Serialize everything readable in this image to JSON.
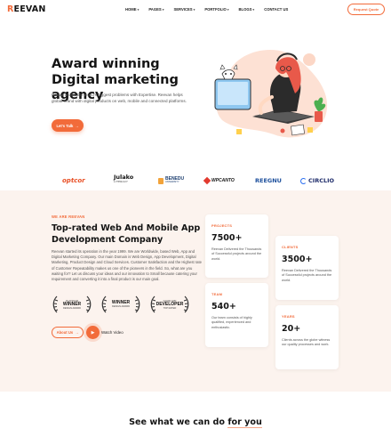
{
  "header": {
    "logo_first": "R",
    "logo_rest": "EEVAN",
    "nav": [
      {
        "label": "HOME",
        "has_dropdown": true
      },
      {
        "label": "PAGES",
        "has_dropdown": true
      },
      {
        "label": "SERVICES",
        "has_dropdown": true
      },
      {
        "label": "PORTFOLIO",
        "has_dropdown": true
      },
      {
        "label": "BLOGS",
        "has_dropdown": true
      },
      {
        "label": "CONTACT US",
        "has_dropdown": false
      }
    ],
    "request_button": "Request Quote"
  },
  "hero": {
    "title_highlight": "Award",
    "title_rest": " winning Digital marketing agency",
    "description": "Reevan solve the world's biggest problems with Expertise. Reevan helps global brand with digital products on web, mobile and connected platforms.",
    "cta_label": "Let's Talk",
    "cta_icon": "arrow-right"
  },
  "brands": [
    {
      "name": "optcor"
    },
    {
      "name": "Julako",
      "sub": "LITERACY"
    },
    {
      "name": "BENEDU",
      "sub": "UNIVERSITY"
    },
    {
      "name": "WPCANTO"
    },
    {
      "name": "REEGNU"
    },
    {
      "name": "CIRCLIO"
    }
  ],
  "about": {
    "eyebrow": "WE ARE REEVAN",
    "title": "Top-rated Web And Mobile App Development Company",
    "description": "Reevan started its operation in the year 1999. We are Worldwide, based Web, App and Digital Marketing Company. Our main Domain is Web Design, App Development, Digital Marketing, Product Design and Cloud Services. Customer Satisfaction and the Highest rate of Customer Repeatability makes us one of the pioneers in the field. So, what are you waiting for? Let us discuss your ideas and our innovation to Small because catering your requirement and converting it into a final product is our main goal.",
    "awards": [
      {
        "line1": "PLATINUM",
        "line2": "WINNER",
        "line3": "DESIGN AWARD"
      },
      {
        "line1": "",
        "line2": "WINNER",
        "line3": "DESIGN AWARD"
      },
      {
        "line1": "GOOD APP",
        "line2": "DEVELOPER",
        "line3": "TOP RATED"
      }
    ],
    "about_button": "About Us",
    "watch_label": "Watch Video"
  },
  "stats": [
    {
      "caption": "PROJECTS",
      "number": "7500+",
      "text": "Reevan Delivered the Thousands of Successful projects around the world."
    },
    {
      "caption": "CLIENTS",
      "number": "3500+",
      "text": "Reevan Delivered the Thousands of Successful projects around the world."
    },
    {
      "caption": "TEAM",
      "number": "540+",
      "text": "Our team consists of highly qualified, experienced and enthusiastic."
    },
    {
      "caption": "YEARS",
      "number": "20+",
      "text": "Clients across the globe witness our quality processes and work."
    }
  ],
  "services": {
    "title_prefix": "See what we can do ",
    "title_highlight": "for you"
  },
  "colors": {
    "accent": "#f26b3a",
    "section_bg": "#fcf3ee",
    "text_dark": "#141414"
  }
}
